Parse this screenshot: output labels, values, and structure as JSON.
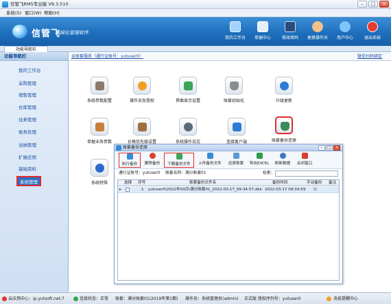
{
  "window": {
    "title": "信管飞RMS专业版 V9.3.510",
    "minimize": "–",
    "maximize": "□",
    "close": "×"
  },
  "menu": [
    "系统(S)",
    "窗口(W)",
    "帮助(H)"
  ],
  "banner": {
    "logo": "信管飞",
    "slogan": "精细化管理软件"
  },
  "toolbar": [
    {
      "label": "我的工作台",
      "color": "#9fd2ff"
    },
    {
      "label": "单据中心",
      "color": "#e6eef7"
    },
    {
      "label": "修改密码",
      "color": "#2a4a7a"
    },
    {
      "label": "更换操作员",
      "color": "#f2c08a"
    },
    {
      "label": "用户中心",
      "color": "#7fc4ff"
    },
    {
      "label": "退出系统",
      "color": "#e63c2f"
    }
  ],
  "tab": {
    "label": "功能导航栏"
  },
  "sidebar": {
    "header": "功能导航栏",
    "items": [
      "我的工作台",
      "采购管理",
      "销售管理",
      "仓库管理",
      "往来管理",
      "账务处理",
      "出纳管理",
      "扩展应用",
      "基础资料",
      "系统管理"
    ],
    "active": "系统管理"
  },
  "linkbar": {
    "left": "云账套服务（通行证账号：yutuser0）",
    "right": "微信扫码绑定"
  },
  "functions": [
    {
      "label": "系统参数配置",
      "icon": "db-gear-icon",
      "color": "#8a7a6a"
    },
    {
      "label": "操作员及授权",
      "icon": "user-icon",
      "color": "#f0a020"
    },
    {
      "label": "界面显示设置",
      "icon": "display-icon",
      "color": "#3aa55a"
    },
    {
      "label": "账套初始化",
      "icon": "database-icon",
      "color": "#8c8c8c"
    },
    {
      "label": "升级更新",
      "icon": "globe-icon",
      "color": "#2e7bd6"
    },
    {
      "label": "单据业务参数",
      "icon": "document-icon",
      "color": "#c8803a"
    },
    {
      "label": "价格优先级设置",
      "icon": "price-icon",
      "color": "#a07040"
    },
    {
      "label": "系统操作日志",
      "icon": "clock-icon",
      "color": "#5a6a7a"
    },
    {
      "label": "连接客户端",
      "icon": "network-icon",
      "color": "#2e7bd6"
    },
    {
      "label": "账套备份还原",
      "icon": "backup-icon",
      "color": "#3a8a5a"
    },
    {
      "label": "系统特殊",
      "icon": "music-icon",
      "color": "#2a6ac8"
    }
  ],
  "dialog": {
    "title": "账套备份还原",
    "buttons": [
      {
        "label": "执行备份",
        "color": "#3a8ad6"
      },
      {
        "label": "删除备份",
        "color": "#d94030"
      },
      {
        "label": "下载备份文件",
        "color": "#3aa55a"
      },
      {
        "label": "上传备份文件",
        "color": "#3a8ad6"
      },
      {
        "label": "还原账套",
        "color": "#5a9ad6"
      },
      {
        "label": "导出EXCEL",
        "color": "#2e9a4a"
      },
      {
        "label": "刷新数据",
        "color": "#3a7ac6"
      },
      {
        "label": "关闭窗口",
        "color": "#d94030"
      }
    ],
    "passport_label": "通行证账号：yutuser0",
    "account_label": "账套名称：满分账套01",
    "search_label": "检索：",
    "search_value": "",
    "columns": [
      "选择",
      "序号",
      "账套备份文件名",
      "备份时间",
      "手动备份",
      "备注"
    ],
    "rows": [
      {
        "seq": "1",
        "file": "yutuser0\\2022年03月\\满分账套01_2022-03-17_09-34-57.dkk",
        "time": "2022-03-17 09:34:59",
        "manual": "☑",
        "remark": ""
      }
    ]
  },
  "statusbar": [
    "云应用中心：ip.yutsoft.net:7",
    "连接状态：正常",
    "账套：满分账套01(2019年第1期)",
    "操作员：系统管理员(admin)",
    "正式版  授权序列号：yutuser0",
    "消息提醒中心"
  ]
}
